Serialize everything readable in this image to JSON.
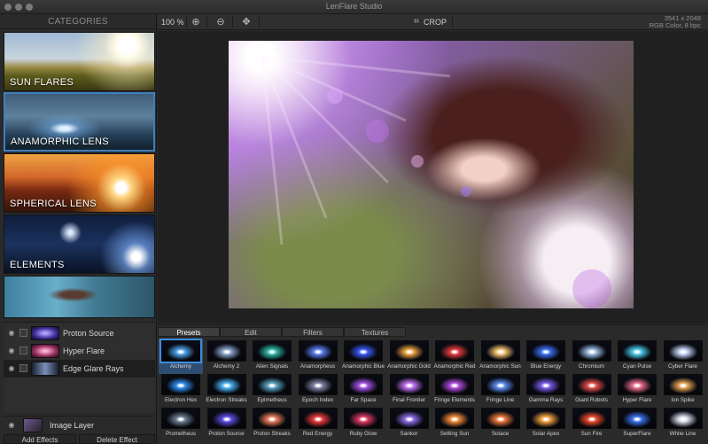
{
  "window": {
    "title": "LenFlare Studio"
  },
  "sidebar": {
    "header": "CATEGORIES",
    "categories": [
      {
        "label": "SUN FLARES",
        "selected": false
      },
      {
        "label": "ANAMORPHIC LENS",
        "selected": true
      },
      {
        "label": "SPHERICAL LENS",
        "selected": false
      },
      {
        "label": "ELEMENTS",
        "selected": false
      },
      {
        "label": "",
        "selected": false
      }
    ],
    "layers": [
      {
        "name": "Proton Source",
        "active": false,
        "color": "#6a4cd8"
      },
      {
        "name": "Hyper Flare",
        "active": false,
        "color": "#d84c7a"
      },
      {
        "name": "Edge Glare Rays",
        "active": true,
        "color": "#7c8fb8"
      }
    ],
    "image_layer": "Image Layer",
    "buttons": {
      "add": "Add Effects",
      "delete": "Delete Effect"
    }
  },
  "toolbar": {
    "zoom": "100 %",
    "crop_label": "CROP",
    "image_size": "3541 x 2048",
    "color_mode": "RGB Color, 8 bpc"
  },
  "presets_panel": {
    "tabs": [
      "Presets",
      "Edit",
      "Filters",
      "Textures"
    ],
    "active_tab": "Presets",
    "presets": [
      {
        "name": "Alchemy",
        "color": "#4aa0e8",
        "active": true
      },
      {
        "name": "Alchemy 2",
        "color": "#8aa0c8"
      },
      {
        "name": "Alien Signals",
        "color": "#2fb8a8"
      },
      {
        "name": "Anamorpheus",
        "color": "#5a7cf0"
      },
      {
        "name": "Anamorphic Blue",
        "color": "#3a58f0"
      },
      {
        "name": "Anamorphic Gold",
        "color": "#e8a040"
      },
      {
        "name": "Anamorphic Red",
        "color": "#e03a3a"
      },
      {
        "name": "Anamorphic Sun",
        "color": "#f0c070"
      },
      {
        "name": "Blue Energy",
        "color": "#3a6ef0"
      },
      {
        "name": "Chromium",
        "color": "#9ab8e0"
      },
      {
        "name": "Cyan Pulse",
        "color": "#4ac8e8"
      },
      {
        "name": "Cyber Flare",
        "color": "#c0d0f0"
      },
      {
        "name": "Electron Hex",
        "color": "#2e8ae8"
      },
      {
        "name": "Electron Streaks",
        "color": "#4ab0f0"
      },
      {
        "name": "Epimetheus",
        "color": "#58a0c0"
      },
      {
        "name": "Epoch Index",
        "color": "#8080a0"
      },
      {
        "name": "Far Space",
        "color": "#a050e0"
      },
      {
        "name": "Final Frontier",
        "color": "#c070f0"
      },
      {
        "name": "Fringe Elements",
        "color": "#b04ad8"
      },
      {
        "name": "Fringe Line",
        "color": "#5a8ae8"
      },
      {
        "name": "Gamma Rays",
        "color": "#7a5ae8"
      },
      {
        "name": "Giant Robots",
        "color": "#e04a4a"
      },
      {
        "name": "Hyper Flare",
        "color": "#e86a8a"
      },
      {
        "name": "Ion Spike",
        "color": "#e0a050"
      },
      {
        "name": "Prometheus",
        "color": "#6a7a90"
      },
      {
        "name": "Proton Source",
        "color": "#5a4ce0"
      },
      {
        "name": "Proton Streaks",
        "color": "#e87a5a"
      },
      {
        "name": "Red Energy",
        "color": "#e83a3a"
      },
      {
        "name": "Ruby Glow",
        "color": "#d83a60"
      },
      {
        "name": "Sankor",
        "color": "#8a6ae0"
      },
      {
        "name": "Setting Sun",
        "color": "#f08a3a"
      },
      {
        "name": "Solace",
        "color": "#e8783a"
      },
      {
        "name": "Solar Apex",
        "color": "#f0a040"
      },
      {
        "name": "Sun Fire",
        "color": "#e84a2a"
      },
      {
        "name": "SuperFlare",
        "color": "#3a70e8"
      },
      {
        "name": "White Line",
        "color": "#d8d8e8"
      }
    ]
  }
}
